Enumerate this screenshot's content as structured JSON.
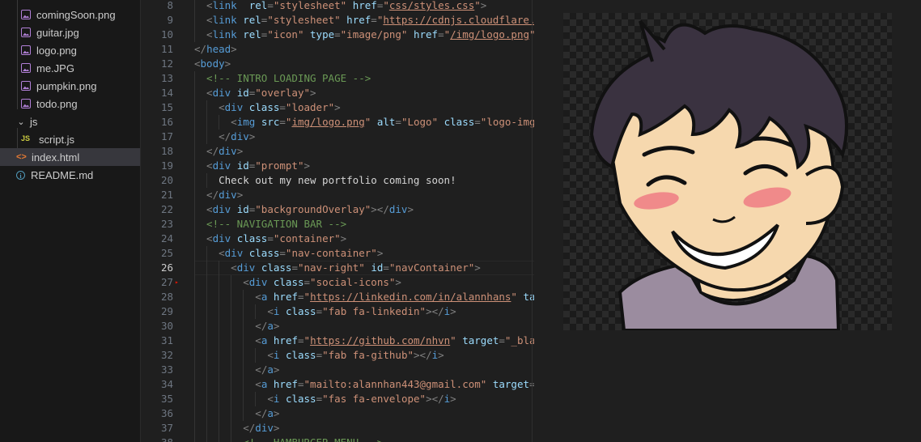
{
  "explorer": {
    "items": [
      {
        "label": "comingSoon.png",
        "type": "image",
        "indent": 2
      },
      {
        "label": "guitar.jpg",
        "type": "image",
        "indent": 2
      },
      {
        "label": "logo.png",
        "type": "image",
        "indent": 2
      },
      {
        "label": "me.JPG",
        "type": "image",
        "indent": 2
      },
      {
        "label": "pumpkin.png",
        "type": "image",
        "indent": 2
      },
      {
        "label": "todo.png",
        "type": "image",
        "indent": 2
      },
      {
        "label": "js",
        "type": "folder",
        "indent": 1
      },
      {
        "label": "script.js",
        "type": "js",
        "indent": 2
      },
      {
        "label": "index.html",
        "type": "html",
        "indent": 1,
        "active": true
      },
      {
        "label": "README.md",
        "type": "info",
        "indent": 1
      }
    ]
  },
  "editor": {
    "current_line": 26,
    "lines": [
      {
        "n": 8,
        "tokens": [
          [
            "t",
            "<"
          ],
          [
            "tag",
            "link"
          ],
          [
            "",
            "  "
          ],
          [
            "attr",
            "rel"
          ],
          [
            "t",
            "="
          ],
          [
            "str",
            "\"stylesheet\""
          ],
          [
            "",
            " "
          ],
          [
            "attr",
            "href"
          ],
          [
            "t",
            "="
          ],
          [
            "str",
            "\""
          ],
          [
            "link",
            "css/styles.css"
          ],
          [
            "str",
            "\""
          ],
          [
            "t",
            ">"
          ]
        ],
        "indent": 1
      },
      {
        "n": 9,
        "tokens": [
          [
            "t",
            "<"
          ],
          [
            "tag",
            "link"
          ],
          [
            "",
            " "
          ],
          [
            "attr",
            "rel"
          ],
          [
            "t",
            "="
          ],
          [
            "str",
            "\"stylesheet\""
          ],
          [
            "",
            " "
          ],
          [
            "attr",
            "href"
          ],
          [
            "t",
            "="
          ],
          [
            "str",
            "\""
          ],
          [
            "link",
            "https://cdnjs.cloudflare."
          ]
        ],
        "indent": 1
      },
      {
        "n": 10,
        "tokens": [
          [
            "t",
            "<"
          ],
          [
            "tag",
            "link"
          ],
          [
            "",
            " "
          ],
          [
            "attr",
            "rel"
          ],
          [
            "t",
            "="
          ],
          [
            "str",
            "\"icon\""
          ],
          [
            "",
            " "
          ],
          [
            "attr",
            "type"
          ],
          [
            "t",
            "="
          ],
          [
            "str",
            "\"image/png\""
          ],
          [
            "",
            " "
          ],
          [
            "attr",
            "href"
          ],
          [
            "t",
            "="
          ],
          [
            "str",
            "\""
          ],
          [
            "link",
            "/img/logo.png"
          ],
          [
            "str",
            "\""
          ]
        ],
        "indent": 1
      },
      {
        "n": 11,
        "tokens": [
          [
            "t",
            "</"
          ],
          [
            "tag",
            "head"
          ],
          [
            "t",
            ">"
          ]
        ],
        "indent": 0
      },
      {
        "n": 12,
        "tokens": [
          [
            "t",
            "<"
          ],
          [
            "tag",
            "body"
          ],
          [
            "t",
            ">"
          ]
        ],
        "indent": 0
      },
      {
        "n": 13,
        "tokens": [
          [
            "cm",
            "<!-- INTRO LOADING PAGE -->"
          ]
        ],
        "indent": 1
      },
      {
        "n": 14,
        "tokens": [
          [
            "t",
            "<"
          ],
          [
            "tag",
            "div"
          ],
          [
            "",
            " "
          ],
          [
            "attr",
            "id"
          ],
          [
            "t",
            "="
          ],
          [
            "str",
            "\"overlay\""
          ],
          [
            "t",
            ">"
          ]
        ],
        "indent": 1
      },
      {
        "n": 15,
        "tokens": [
          [
            "t",
            "<"
          ],
          [
            "tag",
            "div"
          ],
          [
            "",
            " "
          ],
          [
            "attr",
            "class"
          ],
          [
            "t",
            "="
          ],
          [
            "str",
            "\"loader\""
          ],
          [
            "t",
            ">"
          ]
        ],
        "indent": 2
      },
      {
        "n": 16,
        "tokens": [
          [
            "t",
            "<"
          ],
          [
            "tag",
            "img"
          ],
          [
            "",
            " "
          ],
          [
            "attr",
            "src"
          ],
          [
            "t",
            "="
          ],
          [
            "str",
            "\""
          ],
          [
            "link",
            "img/logo.png"
          ],
          [
            "str",
            "\""
          ],
          [
            "",
            " "
          ],
          [
            "attr",
            "alt"
          ],
          [
            "t",
            "="
          ],
          [
            "str",
            "\"Logo\""
          ],
          [
            "",
            " "
          ],
          [
            "attr",
            "class"
          ],
          [
            "t",
            "="
          ],
          [
            "str",
            "\"logo-img"
          ]
        ],
        "indent": 3
      },
      {
        "n": 17,
        "tokens": [
          [
            "t",
            "</"
          ],
          [
            "tag",
            "div"
          ],
          [
            "t",
            ">"
          ]
        ],
        "indent": 2
      },
      {
        "n": 18,
        "tokens": [
          [
            "t",
            "</"
          ],
          [
            "tag",
            "div"
          ],
          [
            "t",
            ">"
          ]
        ],
        "indent": 1
      },
      {
        "n": 19,
        "tokens": [
          [
            "t",
            "<"
          ],
          [
            "tag",
            "div"
          ],
          [
            "",
            " "
          ],
          [
            "attr",
            "id"
          ],
          [
            "t",
            "="
          ],
          [
            "str",
            "\"prompt\""
          ],
          [
            "t",
            ">"
          ]
        ],
        "indent": 1
      },
      {
        "n": 20,
        "tokens": [
          [
            "txt",
            "Check out my new portfolio coming soon!"
          ]
        ],
        "indent": 2
      },
      {
        "n": 21,
        "tokens": [
          [
            "t",
            "</"
          ],
          [
            "tag",
            "div"
          ],
          [
            "t",
            ">"
          ]
        ],
        "indent": 1
      },
      {
        "n": 22,
        "tokens": [
          [
            "t",
            "<"
          ],
          [
            "tag",
            "div"
          ],
          [
            "",
            " "
          ],
          [
            "attr",
            "id"
          ],
          [
            "t",
            "="
          ],
          [
            "str",
            "\"backgroundOverlay\""
          ],
          [
            "t",
            "></"
          ],
          [
            "tag",
            "div"
          ],
          [
            "t",
            ">"
          ]
        ],
        "indent": 1
      },
      {
        "n": 23,
        "tokens": [
          [
            "cm",
            "<!-- NAVIGATION BAR -->"
          ]
        ],
        "indent": 1
      },
      {
        "n": 24,
        "tokens": [
          [
            "t",
            "<"
          ],
          [
            "tag",
            "div"
          ],
          [
            "",
            " "
          ],
          [
            "attr",
            "class"
          ],
          [
            "t",
            "="
          ],
          [
            "str",
            "\"container\""
          ],
          [
            "t",
            ">"
          ]
        ],
        "indent": 1
      },
      {
        "n": 25,
        "tokens": [
          [
            "t",
            "<"
          ],
          [
            "tag",
            "div"
          ],
          [
            "",
            " "
          ],
          [
            "attr",
            "class"
          ],
          [
            "t",
            "="
          ],
          [
            "str",
            "\"nav-container\""
          ],
          [
            "t",
            ">"
          ]
        ],
        "indent": 2
      },
      {
        "n": 26,
        "tokens": [
          [
            "t",
            "<"
          ],
          [
            "tag",
            "div"
          ],
          [
            "",
            " "
          ],
          [
            "attr",
            "class"
          ],
          [
            "t",
            "="
          ],
          [
            "str",
            "\"nav-right\""
          ],
          [
            "",
            " "
          ],
          [
            "attr",
            "id"
          ],
          [
            "t",
            "="
          ],
          [
            "str",
            "\"navContainer\""
          ],
          [
            "t",
            ">"
          ]
        ],
        "indent": 3
      },
      {
        "n": 27,
        "tokens": [
          [
            "t",
            "<"
          ],
          [
            "tag",
            "div"
          ],
          [
            "",
            " "
          ],
          [
            "attr",
            "class"
          ],
          [
            "t",
            "="
          ],
          [
            "str",
            "\"social-icons\""
          ],
          [
            "t",
            ">"
          ]
        ],
        "indent": 4
      },
      {
        "n": 28,
        "tokens": [
          [
            "t",
            "<"
          ],
          [
            "tag",
            "a"
          ],
          [
            "",
            " "
          ],
          [
            "attr",
            "href"
          ],
          [
            "t",
            "="
          ],
          [
            "str",
            "\""
          ],
          [
            "link",
            "https://linkedin.com/in/alannhans"
          ],
          [
            "str",
            "\""
          ],
          [
            "",
            " "
          ],
          [
            "attr",
            "ta"
          ]
        ],
        "indent": 5
      },
      {
        "n": 29,
        "tokens": [
          [
            "t",
            "<"
          ],
          [
            "tag",
            "i"
          ],
          [
            "",
            " "
          ],
          [
            "attr",
            "class"
          ],
          [
            "t",
            "="
          ],
          [
            "str",
            "\"fab fa-linkedin\""
          ],
          [
            "t",
            "></"
          ],
          [
            "tag",
            "i"
          ],
          [
            "t",
            ">"
          ]
        ],
        "indent": 6
      },
      {
        "n": 30,
        "tokens": [
          [
            "t",
            "</"
          ],
          [
            "tag",
            "a"
          ],
          [
            "t",
            ">"
          ]
        ],
        "indent": 5
      },
      {
        "n": 31,
        "tokens": [
          [
            "t",
            "<"
          ],
          [
            "tag",
            "a"
          ],
          [
            "",
            " "
          ],
          [
            "attr",
            "href"
          ],
          [
            "t",
            "="
          ],
          [
            "str",
            "\""
          ],
          [
            "link",
            "https://github.com/nhvn"
          ],
          [
            "str",
            "\""
          ],
          [
            "",
            " "
          ],
          [
            "attr",
            "target"
          ],
          [
            "t",
            "="
          ],
          [
            "str",
            "\"_bla"
          ]
        ],
        "indent": 5
      },
      {
        "n": 32,
        "tokens": [
          [
            "t",
            "<"
          ],
          [
            "tag",
            "i"
          ],
          [
            "",
            " "
          ],
          [
            "attr",
            "class"
          ],
          [
            "t",
            "="
          ],
          [
            "str",
            "\"fab fa-github\""
          ],
          [
            "t",
            "></"
          ],
          [
            "tag",
            "i"
          ],
          [
            "t",
            ">"
          ]
        ],
        "indent": 6
      },
      {
        "n": 33,
        "tokens": [
          [
            "t",
            "</"
          ],
          [
            "tag",
            "a"
          ],
          [
            "t",
            ">"
          ]
        ],
        "indent": 5
      },
      {
        "n": 34,
        "tokens": [
          [
            "t",
            "<"
          ],
          [
            "tag",
            "a"
          ],
          [
            "",
            " "
          ],
          [
            "attr",
            "href"
          ],
          [
            "t",
            "="
          ],
          [
            "str",
            "\"mailto:alannhan443@gmail.com\""
          ],
          [
            "",
            " "
          ],
          [
            "attr",
            "target"
          ],
          [
            "t",
            "="
          ]
        ],
        "indent": 5
      },
      {
        "n": 35,
        "tokens": [
          [
            "t",
            "<"
          ],
          [
            "tag",
            "i"
          ],
          [
            "",
            " "
          ],
          [
            "attr",
            "class"
          ],
          [
            "t",
            "="
          ],
          [
            "str",
            "\"fas fa-envelope\""
          ],
          [
            "t",
            "></"
          ],
          [
            "tag",
            "i"
          ],
          [
            "t",
            ">"
          ]
        ],
        "indent": 6
      },
      {
        "n": 36,
        "tokens": [
          [
            "t",
            "</"
          ],
          [
            "tag",
            "a"
          ],
          [
            "t",
            ">"
          ]
        ],
        "indent": 5
      },
      {
        "n": 37,
        "tokens": [
          [
            "t",
            "</"
          ],
          [
            "tag",
            "div"
          ],
          [
            "t",
            ">"
          ]
        ],
        "indent": 4
      },
      {
        "n": 38,
        "tokens": [
          [
            "cm",
            "<!-- HAMBURGER MENU -->"
          ]
        ],
        "indent": 4
      }
    ]
  },
  "image_preview": {
    "subject": "cartoon-self-portrait",
    "hair_color": "#3a3240",
    "skin_color": "#f6d8ae",
    "blush_color": "#f08080",
    "hoodie_color": "#9a8a9e"
  }
}
